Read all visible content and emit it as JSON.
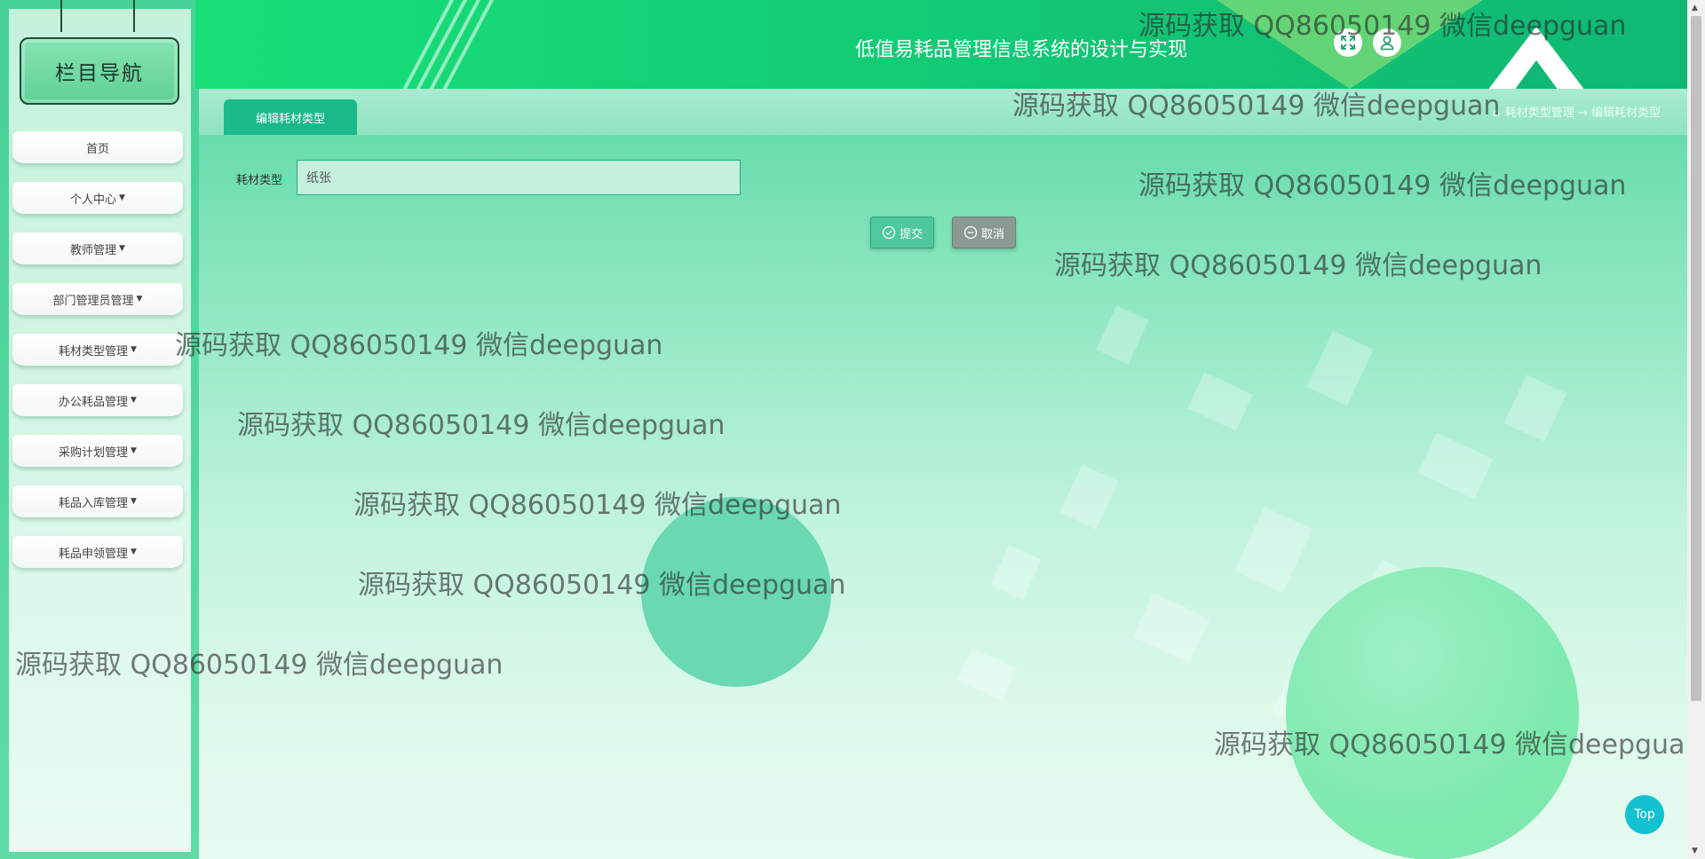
{
  "header": {
    "title": "低值易耗品管理信息系统的设计与实现",
    "fullscreen_icon": "expand-arrows-icon",
    "user_icon": "user-icon"
  },
  "sidebar": {
    "title": "栏目导航",
    "items": [
      {
        "label": "首页",
        "has_caret": false
      },
      {
        "label": "个人中心",
        "has_caret": true
      },
      {
        "label": "教师管理",
        "has_caret": true
      },
      {
        "label": "部门管理员管理",
        "has_caret": true
      },
      {
        "label": "耗材类型管理",
        "has_caret": true
      },
      {
        "label": "办公耗品管理",
        "has_caret": true
      },
      {
        "label": "采购计划管理",
        "has_caret": true
      },
      {
        "label": "耗品入库管理",
        "has_caret": true
      },
      {
        "label": "耗品申领管理",
        "has_caret": true
      }
    ]
  },
  "tabs": [
    {
      "label": "编辑耗材类型",
      "active": true
    }
  ],
  "breadcrumb": {
    "home_icon": "home-icon",
    "path": "耗材类型管理 → 编辑耗材类型"
  },
  "form": {
    "field_label": "耗材类型",
    "field_value": "纸张",
    "submit_label": "提交",
    "cancel_label": "取消"
  },
  "watermark": "源码获取 QQ86050149 微信deepguan",
  "top_button": "Top",
  "colors": {
    "header_green": "#13c876",
    "tab_green": "#1bb88a",
    "top_button": "#12c2d0"
  }
}
